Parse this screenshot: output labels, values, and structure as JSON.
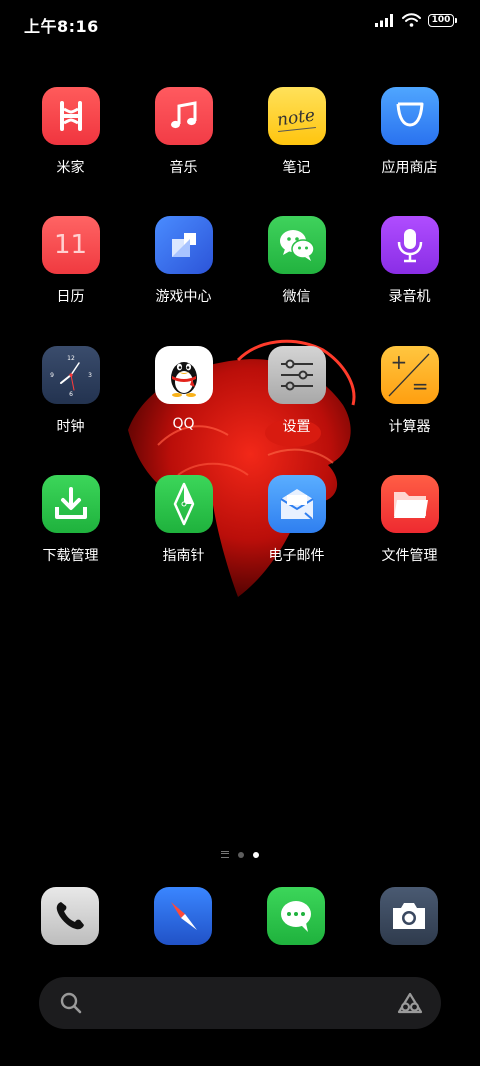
{
  "status_bar": {
    "time": "上午8:16",
    "battery_level": "100",
    "icons": [
      "signal-icon",
      "wifi-icon",
      "battery-icon"
    ]
  },
  "apps": [
    {
      "label": "米家",
      "icon": "mijia-icon",
      "color": "#ff4a4a"
    },
    {
      "label": "音乐",
      "icon": "music-icon",
      "color": "#ff4e50"
    },
    {
      "label": "笔记",
      "icon": "notes-icon",
      "color": "#ffd43b",
      "icon_text": "note"
    },
    {
      "label": "应用商店",
      "icon": "app-store-icon",
      "color": "#3a8dff"
    },
    {
      "label": "日历",
      "icon": "calendar-icon",
      "color": "#ff5454",
      "icon_text": "11"
    },
    {
      "label": "游戏中心",
      "icon": "game-center-icon",
      "color": "#3b73f0"
    },
    {
      "label": "微信",
      "icon": "wechat-icon",
      "color": "#2dc24a"
    },
    {
      "label": "录音机",
      "icon": "recorder-icon",
      "color": "#9b3df2"
    },
    {
      "label": "时钟",
      "icon": "clock-icon",
      "color": "#2c3e5c",
      "clock_numbers": [
        "12",
        "3",
        "6",
        "9"
      ]
    },
    {
      "label": "QQ",
      "icon": "qq-icon",
      "color": "#ffffff"
    },
    {
      "label": "设置",
      "icon": "settings-icon",
      "color": "#b8b8b8"
    },
    {
      "label": "计算器",
      "icon": "calculator-icon",
      "color": "#ffb01f",
      "icon_text_top": "+",
      "icon_text_bottom": "="
    },
    {
      "label": "下载管理",
      "icon": "download-icon",
      "color": "#2bc34a"
    },
    {
      "label": "指南针",
      "icon": "compass-icon",
      "color": "#2bc34a"
    },
    {
      "label": "电子邮件",
      "icon": "email-icon",
      "color": "#3a8dff"
    },
    {
      "label": "文件管理",
      "icon": "file-manager-icon",
      "color": "#ff4a3a"
    }
  ],
  "page_indicator": {
    "pages": 2,
    "current": 2
  },
  "dock": [
    {
      "name": "phone",
      "icon": "phone-icon",
      "color": "#d9d9d9"
    },
    {
      "name": "browser",
      "icon": "browser-compass-icon",
      "color": "#2f6fe0"
    },
    {
      "name": "messages",
      "icon": "message-icon",
      "color": "#2bc34a"
    },
    {
      "name": "camera",
      "icon": "camera-icon",
      "color": "#3c4a5f"
    }
  ],
  "search": {
    "icons": [
      "search-icon",
      "assistant-icon"
    ]
  }
}
